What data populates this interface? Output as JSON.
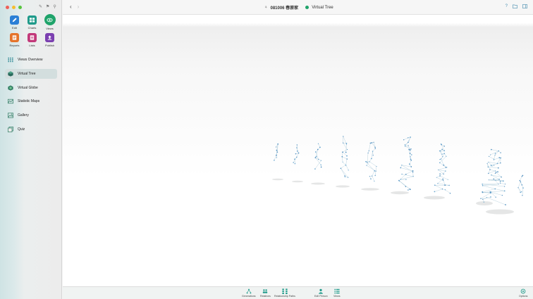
{
  "window": {
    "title": "081006 春原家",
    "subtitle": "Virtual Tree"
  },
  "colors": {
    "accent": "#1fa36a",
    "edit": "#2a7fd6",
    "charts": "#1f9a8a",
    "views": "#1fa36a",
    "reports": "#e5742b",
    "lists": "#c2397a",
    "publish": "#7b3fb0",
    "toolbar_icon": "#4a8fb0"
  },
  "toolbar": {
    "back_icon": "chevron-left-icon",
    "forward_icon": "chevron-right-icon",
    "help_icon": "question-icon",
    "folder_icon": "folder-icon",
    "sidebar_icon": "sidebar-toggle-icon"
  },
  "tiles": [
    {
      "label": "Edit",
      "icon": "pencil-icon"
    },
    {
      "label": "Charts",
      "icon": "charts-icon"
    },
    {
      "label": "Views",
      "icon": "eye-icon"
    },
    {
      "label": "Reports",
      "icon": "reports-icon"
    },
    {
      "label": "Lists",
      "icon": "list-icon"
    },
    {
      "label": "Publish",
      "icon": "upload-icon"
    }
  ],
  "nav": [
    {
      "label": "Views Overview",
      "icon": "grid-icon"
    },
    {
      "label": "Virtual Tree",
      "icon": "cube-icon"
    },
    {
      "label": "Virtual Globe",
      "icon": "globe-icon"
    },
    {
      "label": "Statistic Maps",
      "icon": "map-icon"
    },
    {
      "label": "Gallery",
      "icon": "image-icon"
    },
    {
      "label": "Quiz",
      "icon": "cards-icon"
    }
  ],
  "bottombar": [
    {
      "label": "Generations",
      "icon": "generations-icon"
    },
    {
      "label": "Relatives",
      "icon": "relatives-icon"
    },
    {
      "label": "Relationship Paths",
      "icon": "paths-icon"
    },
    {
      "label": "Edit Person",
      "icon": "person-icon"
    },
    {
      "label": "Views",
      "icon": "views-list-icon"
    },
    {
      "label": "Options",
      "icon": "options-icon"
    }
  ]
}
